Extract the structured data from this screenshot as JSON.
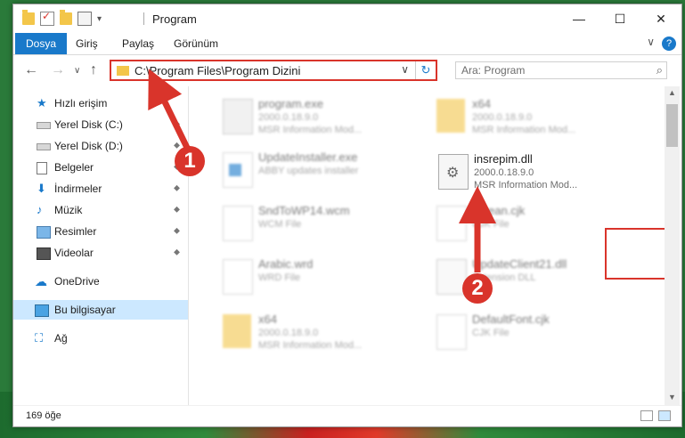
{
  "window": {
    "title": "Program",
    "minimize": "—",
    "maximize": "☐",
    "close": "✕"
  },
  "ribbon": {
    "tabs": [
      "Dosya",
      "Giriş",
      "Paylaş",
      "Görünüm"
    ],
    "help": "?",
    "collapse": "∨"
  },
  "navigation": {
    "back": "←",
    "forward": "→",
    "recent": "∨",
    "up": "↑"
  },
  "address": {
    "path": "C:\\Program Files\\Program Dizini",
    "dropdown": "∨",
    "refresh": "↻"
  },
  "search": {
    "placeholder": "Ara: Program",
    "icon": "search-icon"
  },
  "sidebar": {
    "items": [
      {
        "label": "Hızlı erişim",
        "icon": "star-icon"
      },
      {
        "label": "Yerel Disk (C:)",
        "icon": "drive-icon"
      },
      {
        "label": "Yerel Disk (D:)",
        "icon": "drive-icon"
      },
      {
        "label": "Belgeler",
        "icon": "documents-icon"
      },
      {
        "label": "İndirmeler",
        "icon": "download-icon"
      },
      {
        "label": "Müzik",
        "icon": "music-icon"
      },
      {
        "label": "Resimler",
        "icon": "pictures-icon"
      },
      {
        "label": "Videolar",
        "icon": "videos-icon"
      },
      {
        "label": "OneDrive",
        "icon": "cloud-icon"
      },
      {
        "label": "Bu bilgisayar",
        "icon": "computer-icon"
      },
      {
        "label": "Ağ",
        "icon": "network-icon"
      }
    ],
    "pin": "📌"
  },
  "files": [
    {
      "name": "program.exe",
      "line1": "2000.0.18.9.0",
      "line2": "MSR Information Mod...",
      "icon": "exe-icon"
    },
    {
      "name": "x64",
      "line1": "2000.0.18.9.0",
      "line2": "MSR Information Mod...",
      "icon": "folder-icon"
    },
    {
      "name": "UpdateInstaller.exe",
      "line1": "ABBY updates installer",
      "line2": "",
      "icon": "installer-icon"
    },
    {
      "name": "insrepim.dll",
      "line1": "2000.0.18.9.0",
      "line2": "MSR Information Mod...",
      "icon": "dll-gear-icon"
    },
    {
      "name": "SndToWP14.wcm",
      "line1": "WCM File",
      "line2": "",
      "icon": "file-icon"
    },
    {
      "name": "korean.cjk",
      "line1": "CJK File",
      "line2": "",
      "icon": "file-icon"
    },
    {
      "name": "Arabic.wrd",
      "line1": "WRD File",
      "line2": "",
      "icon": "file-icon"
    },
    {
      "name": "UpdateClient21.dll",
      "line1": "Extension DLL",
      "line2": "",
      "icon": "dll-icon"
    },
    {
      "name": "x64",
      "line1": "2000.0.18.9.0",
      "line2": "MSR Information Mod...",
      "icon": "folder-icon"
    },
    {
      "name": "DefaultFont.cjk",
      "line1": "CJK File",
      "line2": "",
      "icon": "file-icon"
    }
  ],
  "status": {
    "count": "169 öğe"
  },
  "annotations": {
    "badge1": "1",
    "badge2": "2",
    "color": "#d9342b"
  }
}
